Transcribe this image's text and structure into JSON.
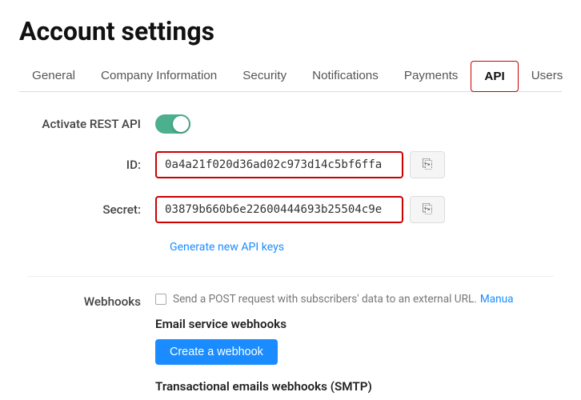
{
  "page": {
    "title": "Account settings"
  },
  "tabs": {
    "items": [
      {
        "label": "General",
        "active": false
      },
      {
        "label": "Company Information",
        "active": false
      },
      {
        "label": "Security",
        "active": false
      },
      {
        "label": "Notifications",
        "active": false
      },
      {
        "label": "Payments",
        "active": false
      },
      {
        "label": "API",
        "active": true
      },
      {
        "label": "Users",
        "active": false
      }
    ]
  },
  "form": {
    "activate_label": "Activate REST API",
    "id_label": "ID:",
    "id_value": "0a4a21f020d36ad02c973d14c5bf6ffa",
    "secret_label": "Secret:",
    "secret_value": "03879b660b6e22600444693b25504c9e",
    "generate_link": "Generate new API keys"
  },
  "webhooks": {
    "label": "Webhooks",
    "description": "Send a POST request with subscribers' data to an external URL.",
    "manual_link": "Manua",
    "email_section_title": "Email service webhooks",
    "create_button": "Create a webhook",
    "transactional_title": "Transactional emails webhooks (SMTP)"
  },
  "icons": {
    "copy": "⎘"
  }
}
